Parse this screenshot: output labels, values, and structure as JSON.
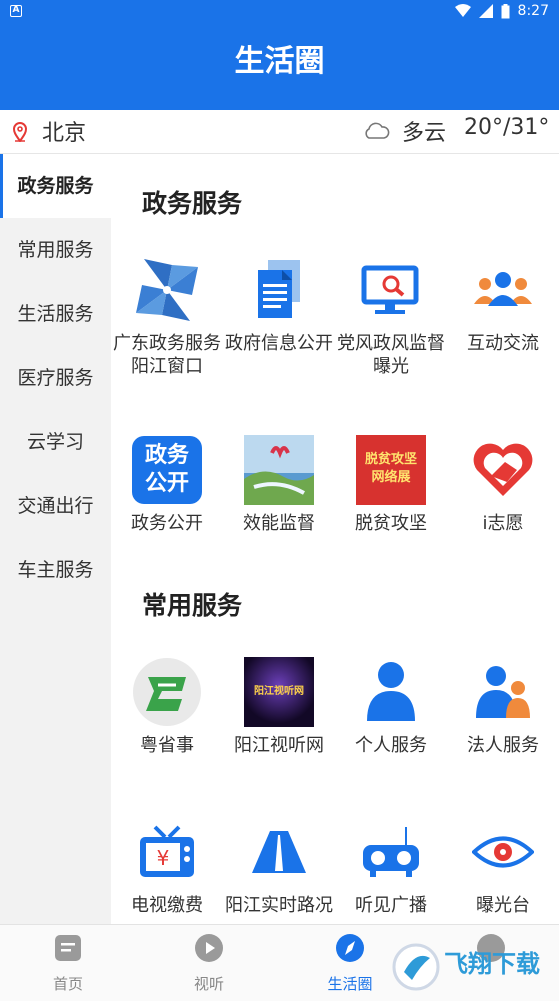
{
  "status_bar": {
    "time": "8:27",
    "notif_letter": "A"
  },
  "header": {
    "title": "生活圈"
  },
  "location": {
    "city": "北京",
    "weather": "多云",
    "temperature": "20°/31°"
  },
  "sidebar": {
    "items": [
      {
        "label": "政务服务",
        "active": true
      },
      {
        "label": "常用服务"
      },
      {
        "label": "生活服务"
      },
      {
        "label": "医疗服务"
      },
      {
        "label": "云学习"
      },
      {
        "label": "交通出行"
      },
      {
        "label": "车主服务"
      }
    ]
  },
  "sections": [
    {
      "title": "政务服务",
      "items": [
        {
          "label": "广东政务服务阳江窗口",
          "icon": "pinwheel-icon"
        },
        {
          "label": "政府信息公开",
          "icon": "documents-icon"
        },
        {
          "label": "党风政风监督曝光",
          "icon": "monitor-search-icon"
        },
        {
          "label": "互动交流",
          "icon": "group-icon"
        },
        {
          "label": "政务公开",
          "icon": "gov-open-badge-icon",
          "badge_text": "政务公开"
        },
        {
          "label": "效能监督",
          "icon": "city-photo-icon"
        },
        {
          "label": "脱贫攻坚",
          "icon": "poverty-banner-icon",
          "badge_text": "脱贫攻坚网络展"
        },
        {
          "label": "i志愿",
          "icon": "heart-hand-icon"
        }
      ]
    },
    {
      "title": "常用服务",
      "items": [
        {
          "label": "粤省事",
          "icon": "yue-logo-icon"
        },
        {
          "label": "阳江视听网",
          "icon": "tv-network-logo-icon",
          "badge_text": "阳江视听网"
        },
        {
          "label": "个人服务",
          "icon": "person-icon"
        },
        {
          "label": "法人服务",
          "icon": "legal-person-icon"
        },
        {
          "label": "电视缴费",
          "icon": "tv-payment-icon"
        },
        {
          "label": "阳江实时路况",
          "icon": "road-icon"
        },
        {
          "label": "听见广播",
          "icon": "radio-icon"
        },
        {
          "label": "曝光台",
          "icon": "eye-icon"
        }
      ]
    }
  ],
  "tabbar": {
    "tabs": [
      {
        "label": "首页",
        "icon": "home-doc-icon"
      },
      {
        "label": "视听",
        "icon": "play-icon"
      },
      {
        "label": "生活圈",
        "icon": "compass-icon",
        "active": true
      },
      {
        "label": "",
        "icon": "profile-icon"
      }
    ]
  },
  "watermark": {
    "text": "飞翔下载"
  },
  "colors": {
    "primary": "#1a73e8",
    "accent_red": "#e53935",
    "accent_orange": "#f08a3c"
  }
}
